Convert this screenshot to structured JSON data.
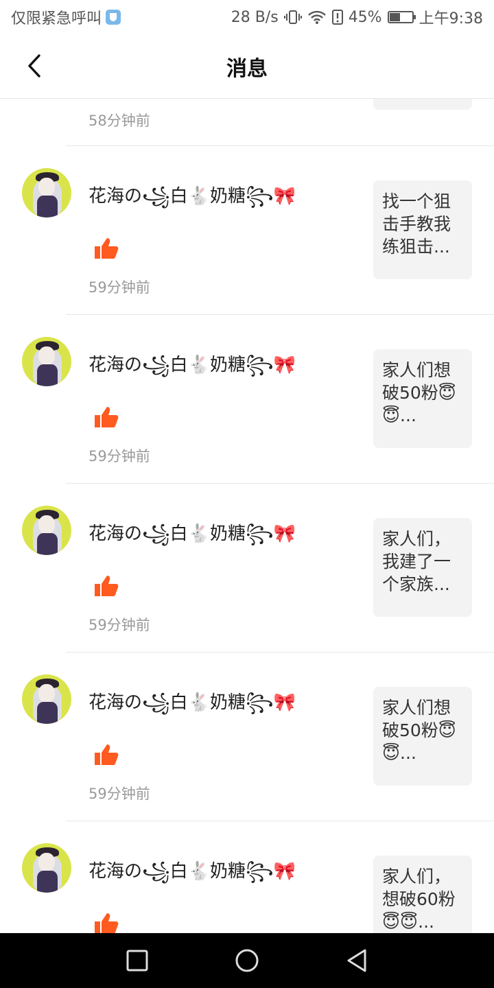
{
  "status_bar": {
    "carrier": "仅限紧急呼叫",
    "speed": "28 B/s",
    "battery": "45%",
    "battery_level": 0.45,
    "time": "上午9:38"
  },
  "header": {
    "title": "消息"
  },
  "partial_row": {
    "time": "58分钟前"
  },
  "messages": [
    {
      "username": "花海の꧁白🐇奶糖꧂🎀",
      "time": "59分钟前",
      "preview": "找一个狙击手教我练狙击..."
    },
    {
      "username": "花海の꧁白🐇奶糖꧂🎀",
      "time": "59分钟前",
      "preview": "家人们想破50粉😇😇..."
    },
    {
      "username": "花海の꧁白🐇奶糖꧂🎀",
      "time": "59分钟前",
      "preview": "家人们，我建了一个家族..."
    },
    {
      "username": "花海の꧁白🐇奶糖꧂🎀",
      "time": "59分钟前",
      "preview": "家人们想破50粉😇😇..."
    },
    {
      "username": "花海の꧁白🐇奶糖꧂🎀",
      "time": "",
      "preview": "家人们，想破60粉😇😇..."
    }
  ],
  "colors": {
    "like": "#ff5a1f",
    "divider": "#e6e6e6",
    "thumb_bg": "#f3f3f3",
    "time_text": "#999999",
    "nav_bg": "#000000"
  },
  "icons": {
    "back": "chevron-left-icon",
    "like": "thumbs-up-icon",
    "nav_recent": "square-icon",
    "nav_home": "circle-icon",
    "nav_back": "triangle-left-icon"
  }
}
